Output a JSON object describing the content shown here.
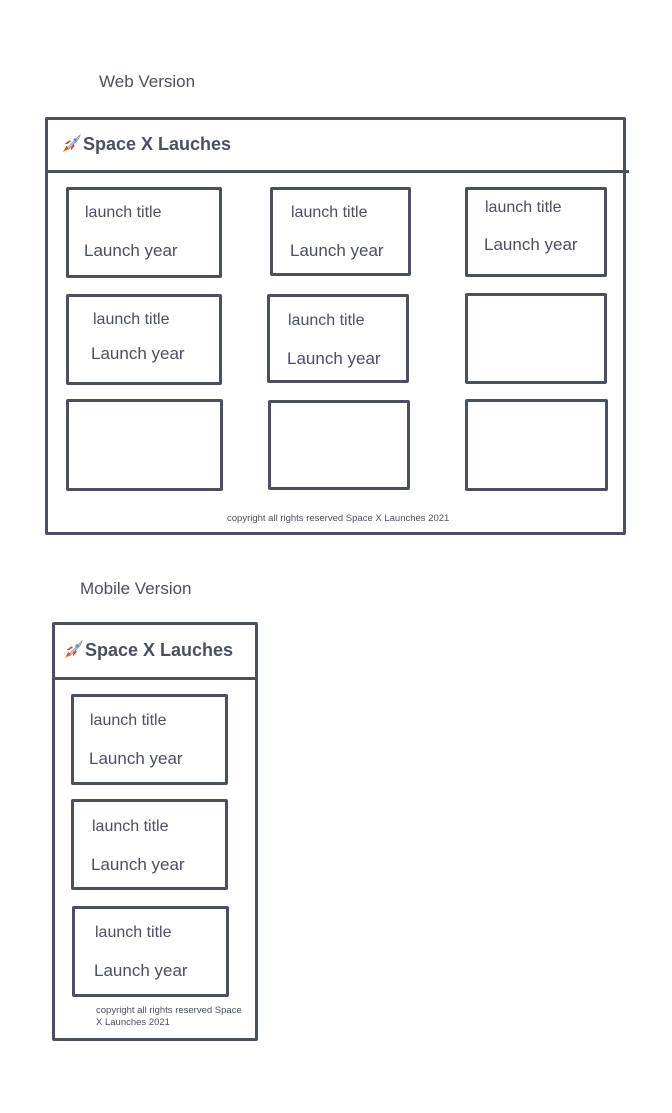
{
  "web": {
    "label": "Web Version",
    "app_title": "Space X Lauches",
    "cards": [
      {
        "title": "launch title",
        "year": "Launch year"
      },
      {
        "title": "launch title",
        "year": "Launch year"
      },
      {
        "title": "launch title",
        "year": "Launch year"
      },
      {
        "title": "launch title",
        "year": "Launch year"
      },
      {
        "title": "launch title",
        "year": "Launch year"
      },
      {
        "title": "",
        "year": ""
      },
      {
        "title": "",
        "year": ""
      },
      {
        "title": "",
        "year": ""
      },
      {
        "title": "",
        "year": ""
      }
    ],
    "footer": "copyright all rights reserved Space X Launches 2021"
  },
  "mobile": {
    "label": "Mobile Version",
    "app_title": "Space X Lauches",
    "cards": [
      {
        "title": "launch title",
        "year": "Launch year"
      },
      {
        "title": "launch title",
        "year": "Launch year"
      },
      {
        "title": "launch title",
        "year": "Launch year"
      }
    ],
    "footer": "copyright all rights reserved Space X Launches 2021"
  },
  "icons": {
    "logo": "rocket-icon"
  },
  "colors": {
    "stroke": "#4a5060",
    "background": "#ffffff"
  }
}
